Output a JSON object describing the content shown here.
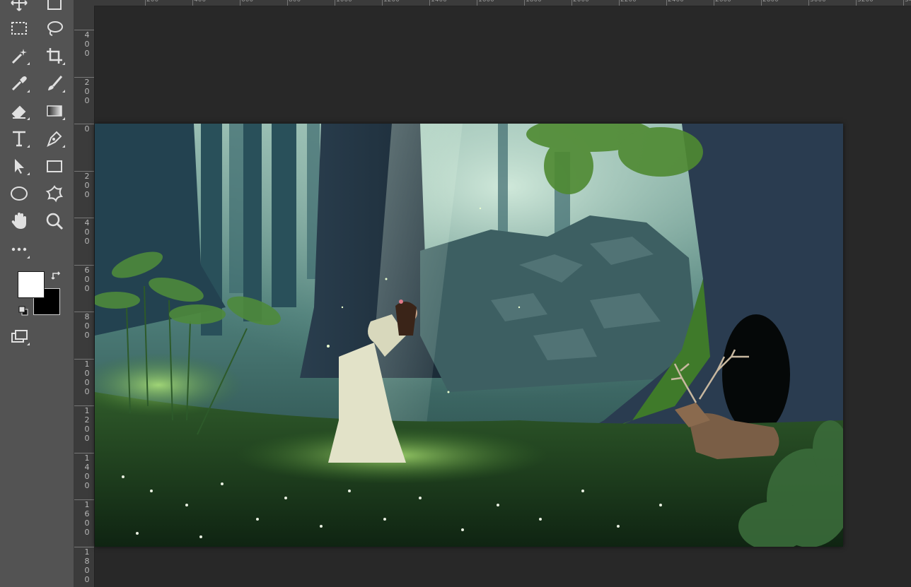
{
  "toolbar": {
    "tools": [
      {
        "name": "move-tool",
        "icon": "move-icon"
      },
      {
        "name": "artboard-tool",
        "icon": "artboard-icon"
      },
      {
        "name": "rectangular-marquee-tool",
        "icon": "marquee-icon"
      },
      {
        "name": "lasso-tool",
        "icon": "lasso-icon"
      },
      {
        "name": "magic-wand-tool",
        "icon": "magic-wand-icon"
      },
      {
        "name": "crop-tool",
        "icon": "crop-icon"
      },
      {
        "name": "eyedropper-tool",
        "icon": "eyedropper-icon"
      },
      {
        "name": "brush-tool",
        "icon": "brush-icon"
      },
      {
        "name": "eraser-tool",
        "icon": "eraser-icon"
      },
      {
        "name": "gradient-tool",
        "icon": "gradient-icon"
      },
      {
        "name": "type-tool",
        "icon": "type-icon",
        "label": "T"
      },
      {
        "name": "pen-tool",
        "icon": "pen-icon"
      },
      {
        "name": "path-selection-tool",
        "icon": "arrow-icon"
      },
      {
        "name": "rectangle-tool",
        "icon": "rectangle-icon"
      },
      {
        "name": "ellipse-tool",
        "icon": "ellipse-icon"
      },
      {
        "name": "custom-shape-tool",
        "icon": "custom-shape-icon"
      },
      {
        "name": "hand-tool",
        "icon": "hand-icon"
      },
      {
        "name": "zoom-tool",
        "icon": "zoom-icon"
      },
      {
        "name": "edit-toolbar",
        "icon": "more-icon",
        "label": "•••"
      },
      {
        "name": "screen-mode",
        "icon": "screen-mode-icon"
      }
    ],
    "foreground_color": "#ffffff",
    "background_color": "#000000"
  },
  "rulers": {
    "top_labels": [
      "200",
      "400",
      "600",
      "800",
      "1000",
      "1200",
      "1400",
      "1600",
      "1800",
      "2000",
      "2200",
      "2400",
      "2600",
      "2800",
      "3000",
      "3200",
      "3400"
    ],
    "left_labels": [
      "400",
      "200",
      "0",
      "200",
      "400",
      "600",
      "800",
      "1000",
      "1200",
      "1400",
      "1600",
      "1800"
    ]
  },
  "canvas": {
    "image_description_icon": "forest-scene-image"
  }
}
